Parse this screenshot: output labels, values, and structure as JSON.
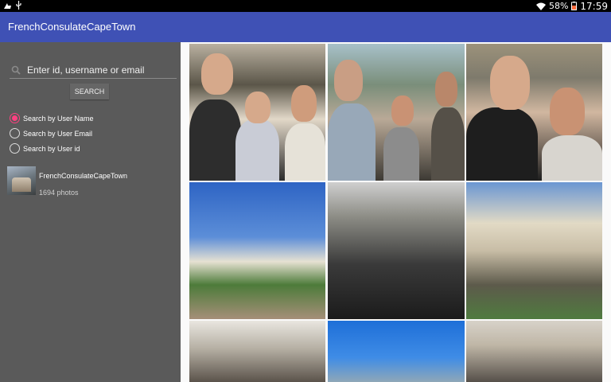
{
  "status_bar": {
    "left_icons": [
      "notification-icon",
      "usb-icon"
    ],
    "wifi_icon": "wifi-icon",
    "battery_percent": "58%",
    "battery_icon": "battery-icon",
    "time": "17:59"
  },
  "app_bar": {
    "title": "FrenchConsulateCapeTown"
  },
  "sidebar": {
    "search": {
      "placeholder": "Enter id, username or email",
      "icon": "search-icon"
    },
    "search_button": "SEARCH",
    "radio_options": [
      {
        "label": "Search by User Name",
        "checked": true
      },
      {
        "label": "Search by User Email",
        "checked": false
      },
      {
        "label": "Search by User id",
        "checked": false
      }
    ],
    "user": {
      "name": "FrenchConsulateCapeTown",
      "count": "1694 photos"
    },
    "accent_color": "#ff4081"
  },
  "colors": {
    "app_bar": "#3f51b5",
    "sidebar": "#5a5a5a"
  }
}
